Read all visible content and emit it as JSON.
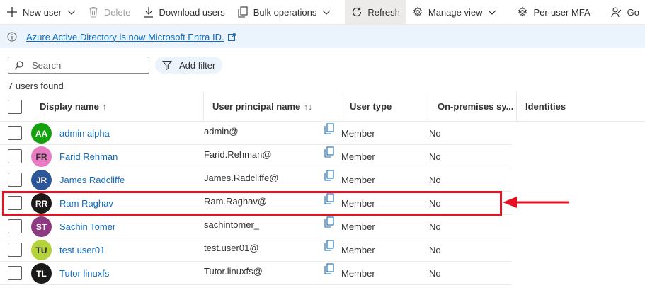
{
  "toolbar": {
    "new_user": "New user",
    "delete": "Delete",
    "download_users": "Download users",
    "bulk_operations": "Bulk operations",
    "refresh": "Refresh",
    "manage_view": "Manage view",
    "per_user_mfa": "Per-user MFA",
    "got_feedback": "Go"
  },
  "banner": {
    "text": "Azure Active Directory is now Microsoft Entra ID."
  },
  "search": {
    "placeholder": "Search"
  },
  "filter": {
    "label": "Add filter"
  },
  "results": {
    "count_text": "7 users found"
  },
  "table": {
    "columns": {
      "display_name": "Display name",
      "display_name_sort": "↑",
      "upn": "User principal name",
      "upn_sort": "↑↓",
      "user_type": "User type",
      "on_prem": "On-premises sy...",
      "identities": "Identities"
    },
    "rows": [
      {
        "initials": "AA",
        "avatar_color": "#13a10e",
        "name": "admin alpha",
        "upn": "admin@",
        "type": "Member",
        "on_prem": "No"
      },
      {
        "initials": "FR",
        "avatar_color": "#e87cc2",
        "name": "Farid Rehman",
        "upn": "Farid.Rehman@",
        "type": "Member",
        "on_prem": "No"
      },
      {
        "initials": "JR",
        "avatar_color": "#2b579a",
        "name": "James Radcliffe",
        "upn": "James.Radcliffe@",
        "type": "Member",
        "on_prem": "No"
      },
      {
        "initials": "RR",
        "avatar_color": "#1b1a19",
        "name": "Ram Raghav",
        "upn": "Ram.Raghav@",
        "type": "Member",
        "on_prem": "No"
      },
      {
        "initials": "ST",
        "avatar_color": "#8e3a82",
        "name": "Sachin Tomer",
        "upn": "sachintomer_",
        "type": "Member",
        "on_prem": "No"
      },
      {
        "initials": "TU",
        "avatar_color": "#b4d33a",
        "name": "test user01",
        "upn": "test.user01@",
        "type": "Member",
        "on_prem": "No"
      },
      {
        "initials": "TL",
        "avatar_color": "#1b1a19",
        "name": "Tutor linuxfs",
        "upn": "Tutor.linuxfs@",
        "type": "Member",
        "on_prem": "No"
      }
    ]
  },
  "annotation": {
    "highlight_color": "#e81123",
    "highlighted_user": "Ram Raghav"
  },
  "colors": {
    "accent": "#0f6cbd",
    "banner_bg": "#ebf3fc"
  }
}
